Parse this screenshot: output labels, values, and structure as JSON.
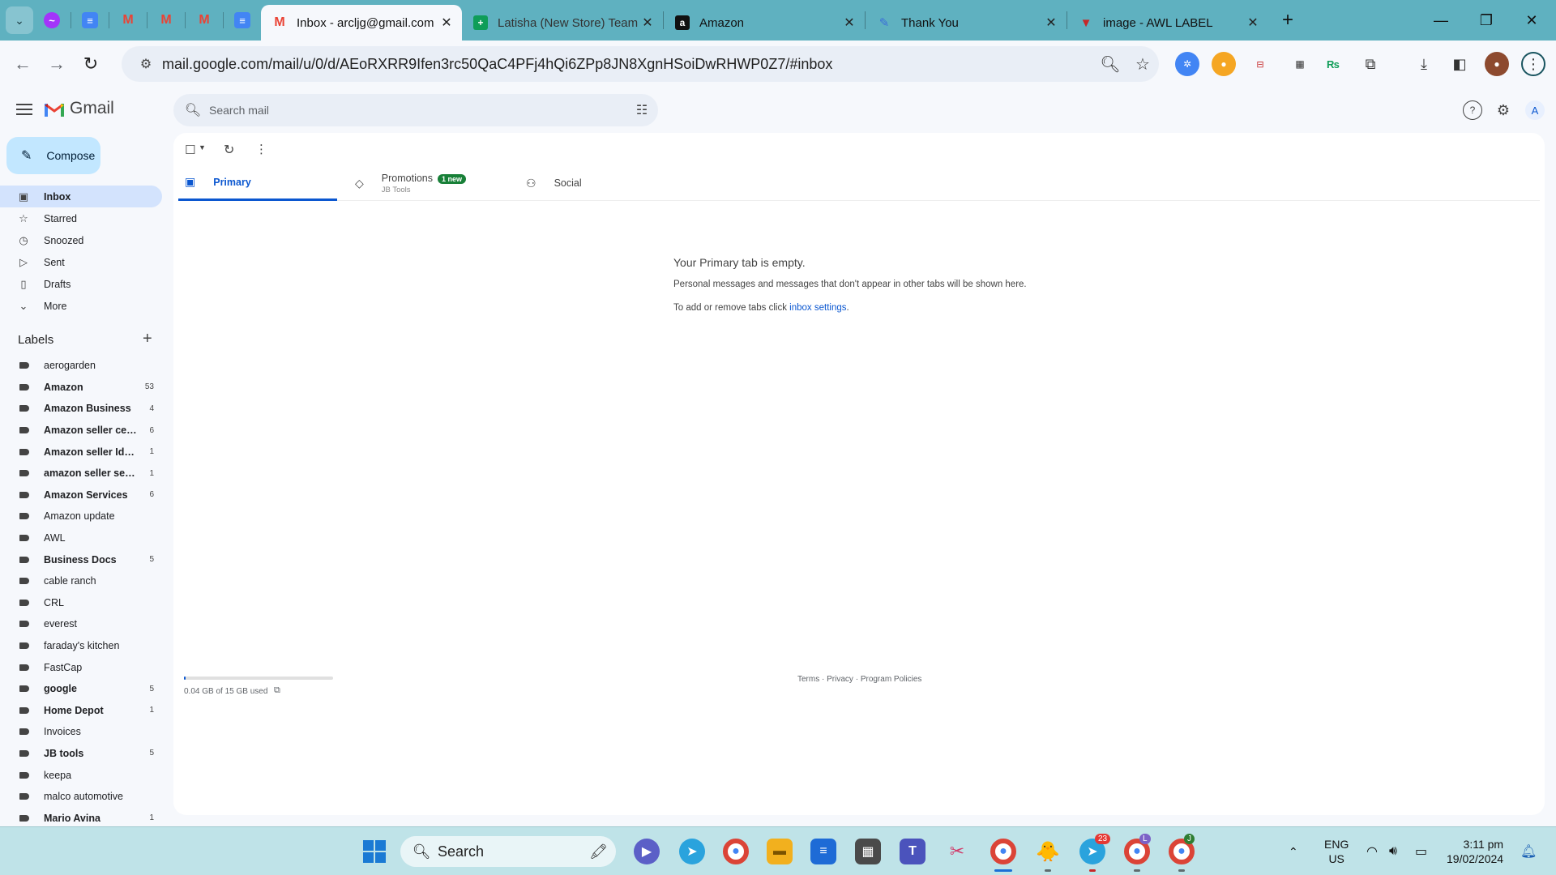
{
  "browser": {
    "pinned_tabs": [
      {
        "icon": "messenger-icon",
        "color": "#a334fa"
      },
      {
        "icon": "google-docs-icon",
        "color": "#4285f4"
      },
      {
        "icon": "gmail-icon",
        "color": "#ea4335"
      },
      {
        "icon": "gmail-icon",
        "color": "#ea4335"
      },
      {
        "icon": "gmail-icon",
        "color": "#ea4335"
      },
      {
        "icon": "google-docs-icon",
        "color": "#4285f4"
      }
    ],
    "tabs": [
      {
        "title": "Inbox - arcljg@gmail.com",
        "icon": "gmail-icon",
        "active": true
      },
      {
        "title": "Latisha (New Store) Team",
        "icon": "google-sheets-icon",
        "active": false
      },
      {
        "title": "Amazon",
        "icon": "amazon-icon",
        "active": false
      },
      {
        "title": "Thank You",
        "icon": "pencil-icon",
        "active": false
      },
      {
        "title": "image - AWL LABEL",
        "icon": "label-icon",
        "active": false
      }
    ],
    "url": "mail.google.com/mail/u/0/d/AEoRXRR9Ifen3rc50QaC4PFj4hQi6ZPp8JN8XgnHSoiDwRHWP0Z7/#inbox"
  },
  "gmail": {
    "app_name": "Gmail",
    "search_placeholder": "Search mail",
    "compose_label": "Compose",
    "nav": [
      {
        "label": "Inbox",
        "icon": "inbox-icon",
        "active": true
      },
      {
        "label": "Starred",
        "icon": "star-icon",
        "active": false
      },
      {
        "label": "Snoozed",
        "icon": "clock-icon",
        "active": false
      },
      {
        "label": "Sent",
        "icon": "send-icon",
        "active": false
      },
      {
        "label": "Drafts",
        "icon": "draft-icon",
        "active": false
      },
      {
        "label": "More",
        "icon": "chevron-down-icon",
        "active": false
      }
    ],
    "labels_title": "Labels",
    "labels": [
      {
        "name": "aerogarden",
        "count": "",
        "bold": false
      },
      {
        "name": "Amazon",
        "count": "53",
        "bold": true
      },
      {
        "name": "Amazon Business",
        "count": "4",
        "bold": true
      },
      {
        "name": "Amazon seller central",
        "count": "6",
        "bold": true
      },
      {
        "name": "Amazon seller Ident",
        "count": "1",
        "bold": true
      },
      {
        "name": "amazon seller services",
        "count": "1",
        "bold": true
      },
      {
        "name": "Amazon Services",
        "count": "6",
        "bold": true
      },
      {
        "name": "Amazon update",
        "count": "",
        "bold": false
      },
      {
        "name": "AWL",
        "count": "",
        "bold": false
      },
      {
        "name": "Business Docs",
        "count": "5",
        "bold": true
      },
      {
        "name": "cable ranch",
        "count": "",
        "bold": false
      },
      {
        "name": "CRL",
        "count": "",
        "bold": false
      },
      {
        "name": "everest",
        "count": "",
        "bold": false
      },
      {
        "name": "faraday's kitchen",
        "count": "",
        "bold": false
      },
      {
        "name": "FastCap",
        "count": "",
        "bold": false
      },
      {
        "name": "google",
        "count": "5",
        "bold": true
      },
      {
        "name": "Home Depot",
        "count": "1",
        "bold": true
      },
      {
        "name": "Invoices",
        "count": "",
        "bold": false
      },
      {
        "name": "JB tools",
        "count": "5",
        "bold": true
      },
      {
        "name": "keepa",
        "count": "",
        "bold": false
      },
      {
        "name": "malco automotive",
        "count": "",
        "bold": false
      },
      {
        "name": "Mario Avina",
        "count": "1",
        "bold": true
      }
    ],
    "tabs": {
      "primary": "Primary",
      "promotions": "Promotions",
      "promotions_badge": "1 new",
      "promotions_sub": "JB Tools",
      "social": "Social"
    },
    "empty": {
      "title": "Your Primary tab is empty.",
      "line1": "Personal messages and messages that don't appear in other tabs will be shown here.",
      "line2_prefix": "To add or remove tabs click ",
      "line2_link": "inbox settings",
      "line2_suffix": "."
    },
    "storage": {
      "text": "0.04 GB of 15 GB used",
      "fraction": 0.003
    },
    "footer": {
      "terms": "Terms",
      "privacy": "Privacy",
      "policies": "Program Policies",
      "separator": " · "
    }
  },
  "taskbar": {
    "search_label": "Search",
    "language": "ENG",
    "region": "US",
    "time": "3:11 pm",
    "date": "19/02/2024",
    "telegram_badge": "23",
    "chrome_badge_1": "L",
    "chrome_badge_2": "J"
  }
}
